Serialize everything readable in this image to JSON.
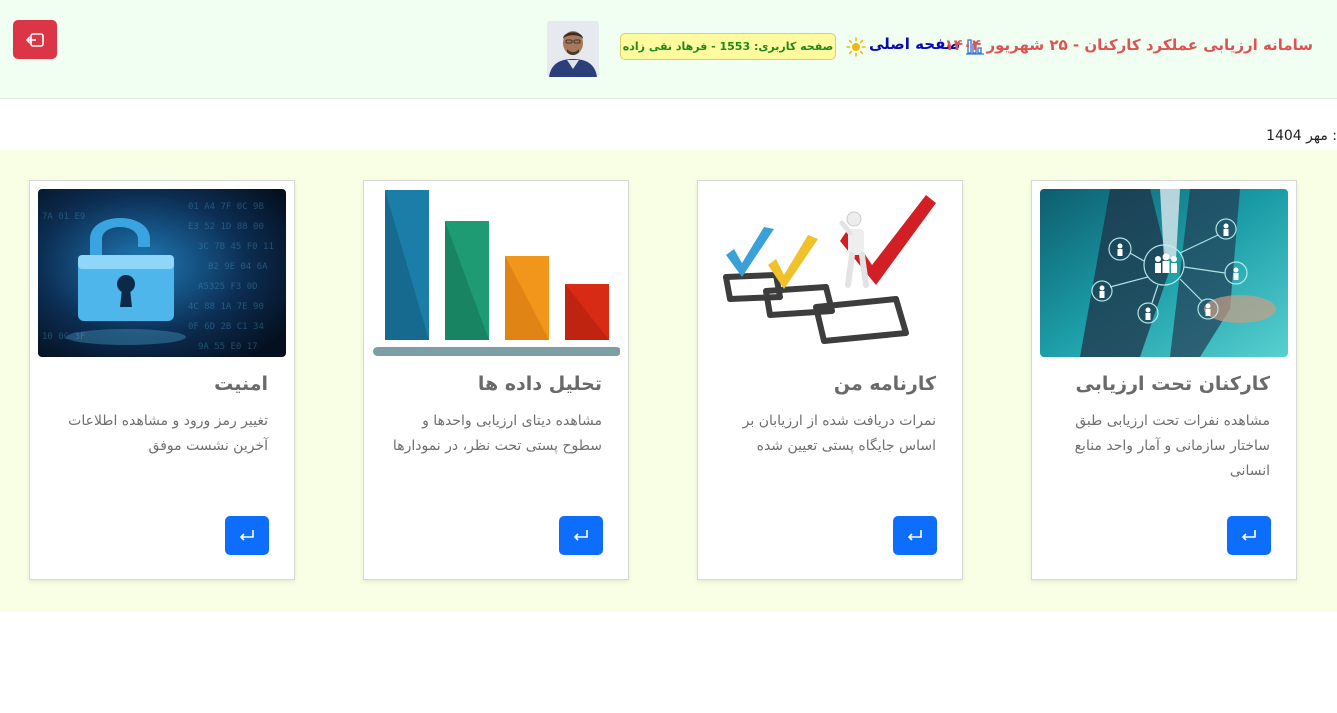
{
  "header": {
    "app_title": "سامانه ارزیابی عملکرد کارکنان - ۲۵ شهریور ۱۴۰۴",
    "home_label": "صفحه اصلی",
    "user_badge": "صفحه کاربری: 1553 - فرهاد نقی زاده",
    "logout_icon": "logout-icon",
    "colors": {
      "header_bg": "#f0fff2",
      "title": "#e05252",
      "home_link": "#0a0ab4",
      "badge_bg": "#fffb9e",
      "badge_text": "#1e8a1e",
      "logout": "#dc3545"
    }
  },
  "date_line": ": مهر 1404",
  "cards": [
    {
      "title": "کارکنان تحت ارزیابی",
      "text": "مشاهده نفرات تحت ارزیابی طبق ساختار سازمانی و آمار واحد منابع انسانی",
      "image": "people-network-image",
      "button_icon": "enter-arrow-icon"
    },
    {
      "title": "کارنامه من",
      "text": "نمرات دریافت شده از ارزیابان بر اساس جایگاه پستی تعیین شده",
      "image": "checkmarks-image",
      "button_icon": "enter-arrow-icon"
    },
    {
      "title": "تحلیل داده ها",
      "text": "مشاهده دیتای ارزیابی واحدها و سطوح پستی تحت نظر، در نمودارها",
      "image": "bar-chart-image",
      "button_icon": "enter-arrow-icon"
    },
    {
      "title": "امنیت",
      "text": "تغییر رمز ورود و مشاهده اطلاعات آخرین نشست موفق",
      "image": "padlock-image",
      "button_icon": "enter-arrow-icon"
    }
  ],
  "colors": {
    "band_bg": "#f8ffe4",
    "card_button": "#0d6efd"
  }
}
